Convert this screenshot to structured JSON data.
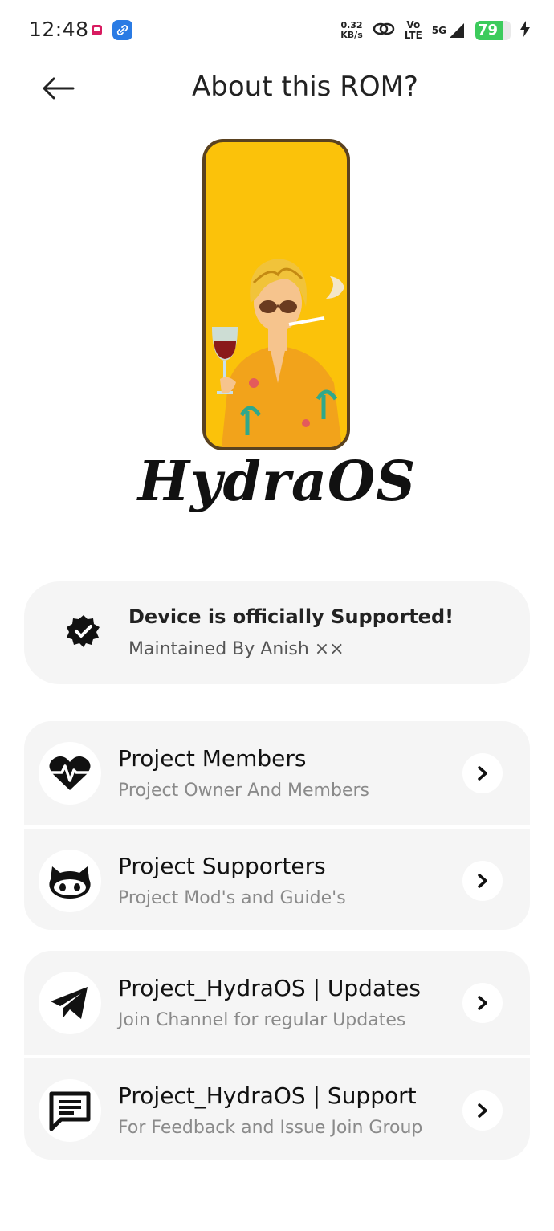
{
  "status_bar": {
    "time": "12:48",
    "speed_value": "0.32",
    "speed_unit": "KB/s",
    "volte_top": "Vo",
    "volte_bottom": "LTE",
    "network": "5G",
    "battery": "79",
    "battery_color": "#3ccb5c"
  },
  "header": {
    "title": "About this ROM?",
    "back_icon": "arrow-left-icon"
  },
  "hero": {
    "image": "rom-mascot-illustration",
    "rom_name": "HydraOS",
    "background_color": "#fbc20a"
  },
  "support_card": {
    "icon": "verified-badge-icon",
    "title": "Device is officially Supported!",
    "subtitle": "Maintained By Anish ××"
  },
  "groups": [
    {
      "items": [
        {
          "icon": "heartbeat-icon",
          "title": "Project Members",
          "subtitle": "Project Owner And Members"
        },
        {
          "icon": "github-icon",
          "title": "Project Supporters",
          "subtitle": "Project Mod's and Guide's"
        }
      ]
    },
    {
      "items": [
        {
          "icon": "telegram-icon",
          "title": "Project_HydraOS | Updates",
          "subtitle": "Join Channel for regular Updates"
        },
        {
          "icon": "chat-icon",
          "title": "Project_HydraOS | Support",
          "subtitle": "For Feedback and Issue Join Group"
        }
      ]
    }
  ]
}
